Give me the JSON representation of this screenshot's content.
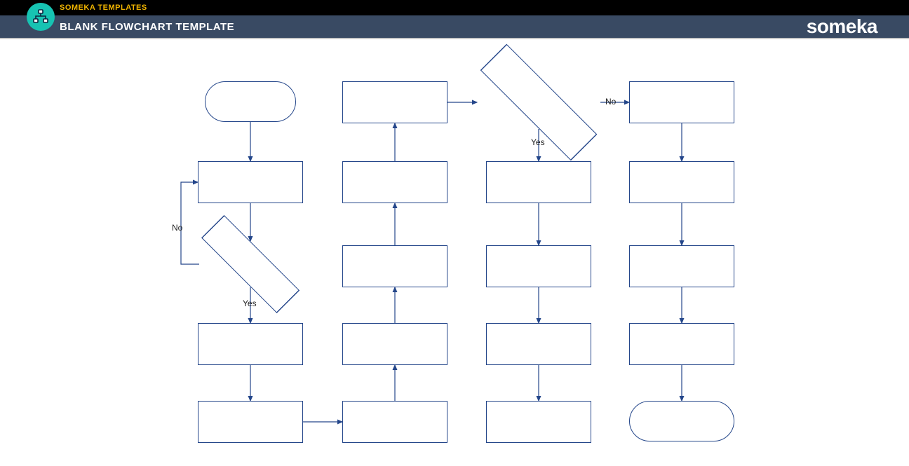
{
  "header": {
    "category": "SOMEKA TEMPLATES",
    "title": "BLANK FLOWCHART TEMPLATE",
    "brand": "someka"
  },
  "labels": {
    "no_top": "No",
    "yes_top": "Yes",
    "no_left": "No",
    "yes_left": "Yes"
  },
  "chart_data": {
    "type": "flowchart",
    "title": "Blank Flowchart Template",
    "nodes": [
      {
        "id": "A1",
        "kind": "terminator",
        "text": "",
        "col": 1,
        "row": 1
      },
      {
        "id": "A2",
        "kind": "process",
        "text": "",
        "col": 1,
        "row": 2
      },
      {
        "id": "A3",
        "kind": "decision",
        "text": "",
        "col": 1,
        "row": 3
      },
      {
        "id": "A4",
        "kind": "process",
        "text": "",
        "col": 1,
        "row": 4
      },
      {
        "id": "A5",
        "kind": "process",
        "text": "",
        "col": 1,
        "row": 5
      },
      {
        "id": "B1",
        "kind": "process",
        "text": "",
        "col": 2,
        "row": 1
      },
      {
        "id": "B2",
        "kind": "process",
        "text": "",
        "col": 2,
        "row": 2
      },
      {
        "id": "B3",
        "kind": "process",
        "text": "",
        "col": 2,
        "row": 3
      },
      {
        "id": "B4",
        "kind": "process",
        "text": "",
        "col": 2,
        "row": 4
      },
      {
        "id": "B5",
        "kind": "process",
        "text": "",
        "col": 2,
        "row": 5
      },
      {
        "id": "C1",
        "kind": "decision",
        "text": "",
        "col": 3,
        "row": 1
      },
      {
        "id": "C2",
        "kind": "process",
        "text": "",
        "col": 3,
        "row": 2
      },
      {
        "id": "C3",
        "kind": "process",
        "text": "",
        "col": 3,
        "row": 3
      },
      {
        "id": "C4",
        "kind": "process",
        "text": "",
        "col": 3,
        "row": 4
      },
      {
        "id": "C5",
        "kind": "process",
        "text": "",
        "col": 3,
        "row": 5
      },
      {
        "id": "D1",
        "kind": "process",
        "text": "",
        "col": 4,
        "row": 1
      },
      {
        "id": "D2",
        "kind": "process",
        "text": "",
        "col": 4,
        "row": 2
      },
      {
        "id": "D3",
        "kind": "process",
        "text": "",
        "col": 4,
        "row": 3
      },
      {
        "id": "D4",
        "kind": "process",
        "text": "",
        "col": 4,
        "row": 4
      },
      {
        "id": "D5",
        "kind": "terminator",
        "text": "",
        "col": 4,
        "row": 5
      }
    ],
    "edges": [
      {
        "from": "A1",
        "to": "A2",
        "dir": "down"
      },
      {
        "from": "A2",
        "to": "A3",
        "dir": "down"
      },
      {
        "from": "A3",
        "to": "A2",
        "dir": "left-up",
        "label": "No"
      },
      {
        "from": "A3",
        "to": "A4",
        "dir": "down",
        "label": "Yes"
      },
      {
        "from": "A4",
        "to": "A5",
        "dir": "down"
      },
      {
        "from": "A5",
        "to": "B5",
        "dir": "right"
      },
      {
        "from": "B5",
        "to": "B4",
        "dir": "up"
      },
      {
        "from": "B4",
        "to": "B3",
        "dir": "up"
      },
      {
        "from": "B3",
        "to": "B2",
        "dir": "up"
      },
      {
        "from": "B2",
        "to": "B1",
        "dir": "up"
      },
      {
        "from": "B1",
        "to": "C1",
        "dir": "right"
      },
      {
        "from": "C1",
        "to": "D1",
        "dir": "right",
        "label": "No"
      },
      {
        "from": "C1",
        "to": "C2",
        "dir": "down",
        "label": "Yes"
      },
      {
        "from": "C2",
        "to": "C3",
        "dir": "down"
      },
      {
        "from": "C3",
        "to": "C4",
        "dir": "down"
      },
      {
        "from": "C4",
        "to": "C5",
        "dir": "down"
      },
      {
        "from": "D1",
        "to": "D2",
        "dir": "down"
      },
      {
        "from": "D2",
        "to": "D3",
        "dir": "down"
      },
      {
        "from": "D3",
        "to": "D4",
        "dir": "down"
      },
      {
        "from": "D4",
        "to": "D5",
        "dir": "down"
      }
    ]
  }
}
